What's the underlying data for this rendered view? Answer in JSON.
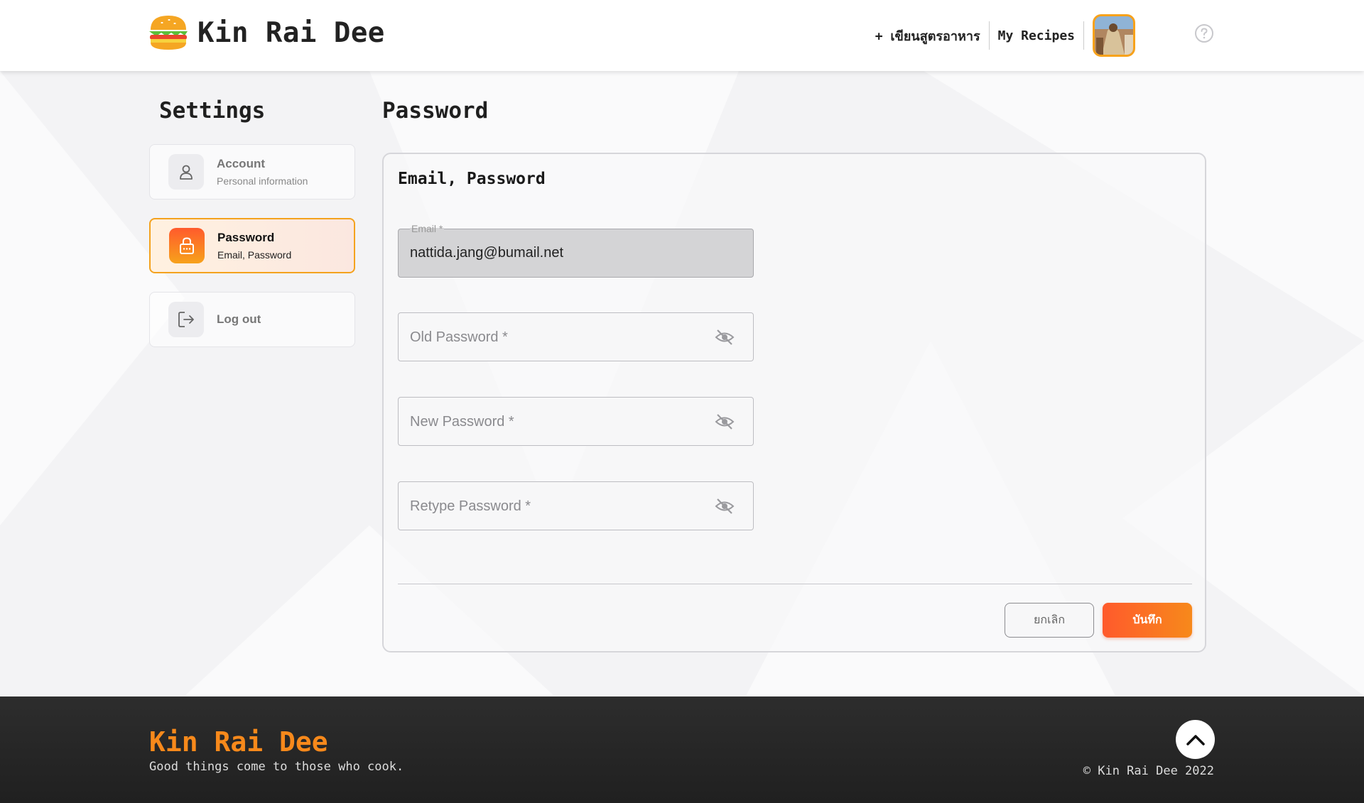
{
  "header": {
    "brand": "Kin Rai Dee",
    "nav_write_recipe": "+ เขียนสูตรอาหาร",
    "nav_my_recipes": "My Recipes"
  },
  "sidebar": {
    "title": "Settings",
    "items": [
      {
        "label": "Account",
        "sub": "Personal information",
        "icon": "person-icon"
      },
      {
        "label": "Password",
        "sub": "Email, Password",
        "icon": "lock-icon",
        "active": true
      },
      {
        "label": "Log out",
        "sub": "",
        "icon": "logout-icon"
      }
    ]
  },
  "main": {
    "title": "Password",
    "panel_title": "Email, Password",
    "email": {
      "label": "Email *",
      "value": "nattida.jang@bumail.net"
    },
    "old_password": {
      "placeholder": "Old Password *"
    },
    "new_password": {
      "placeholder": "New Password *"
    },
    "retype_password": {
      "placeholder": "Retype Password *"
    },
    "cancel_label": "ยกเลิก",
    "save_label": "บันทึก"
  },
  "footer": {
    "brand": "Kin Rai Dee",
    "tagline": "Good things come to those who cook.",
    "copyright": "© Kin Rai Dee 2022"
  },
  "colors": {
    "accent_orange": "#f7891b",
    "accent_red": "#ff5a2c",
    "footer_bg": "#2a2a2a"
  }
}
